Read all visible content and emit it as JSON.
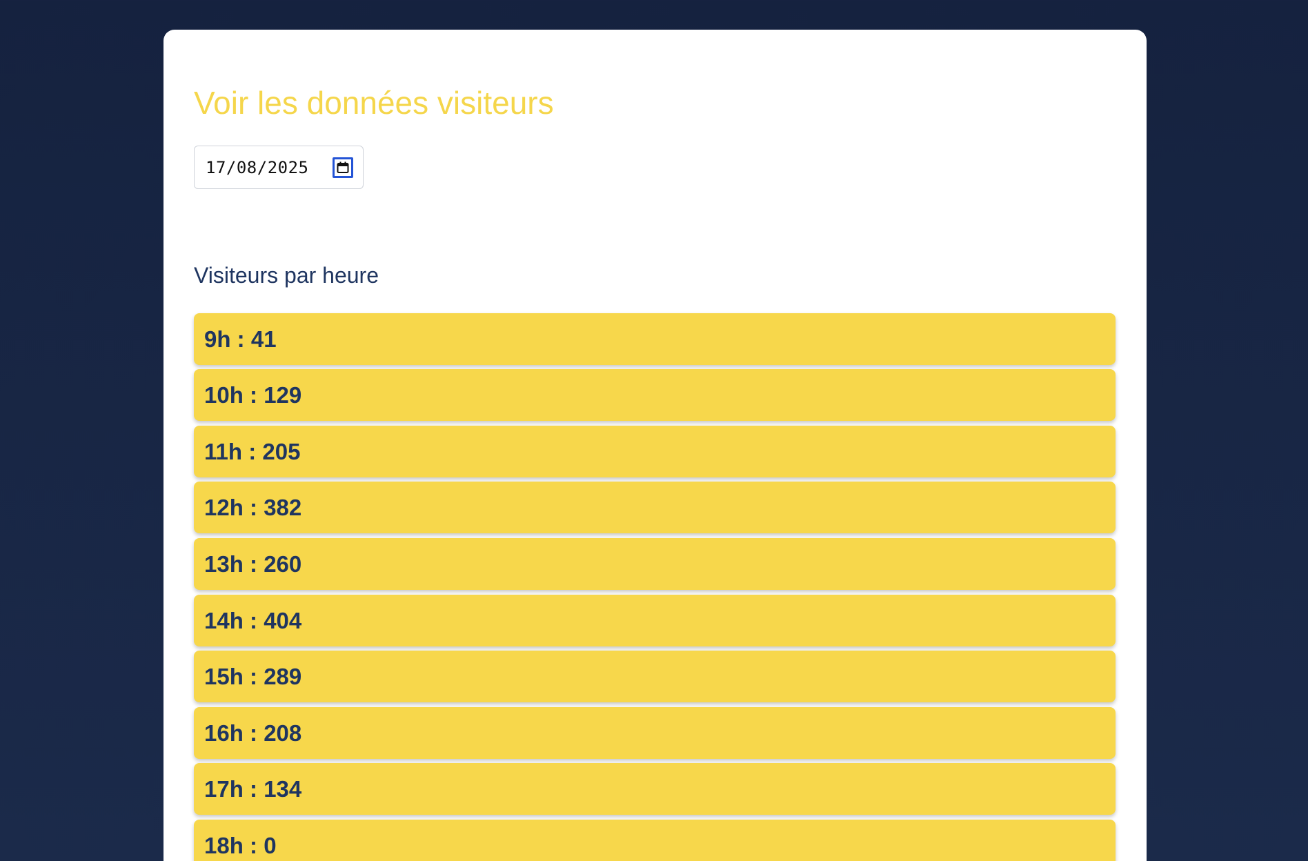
{
  "page": {
    "title": "Voir les données visiteurs",
    "date_value": "17/08/2025",
    "section_title": "Visiteurs par heure"
  },
  "hours": [
    {
      "hour": "9h",
      "count": "41"
    },
    {
      "hour": "10h",
      "count": "129"
    },
    {
      "hour": "11h",
      "count": "205"
    },
    {
      "hour": "12h",
      "count": "382"
    },
    {
      "hour": "13h",
      "count": "260"
    },
    {
      "hour": "14h",
      "count": "404"
    },
    {
      "hour": "15h",
      "count": "289"
    },
    {
      "hour": "16h",
      "count": "208"
    },
    {
      "hour": "17h",
      "count": "134"
    },
    {
      "hour": "18h",
      "count": "0"
    }
  ],
  "icons": {
    "date_picker": "calendar-icon"
  },
  "colors": {
    "background": "#15223f",
    "card": "#ffffff",
    "accent_yellow": "#f7d74b",
    "title_yellow": "#f5d64b",
    "navy_text": "#1f3560",
    "calendar_blue": "#2454d6"
  }
}
